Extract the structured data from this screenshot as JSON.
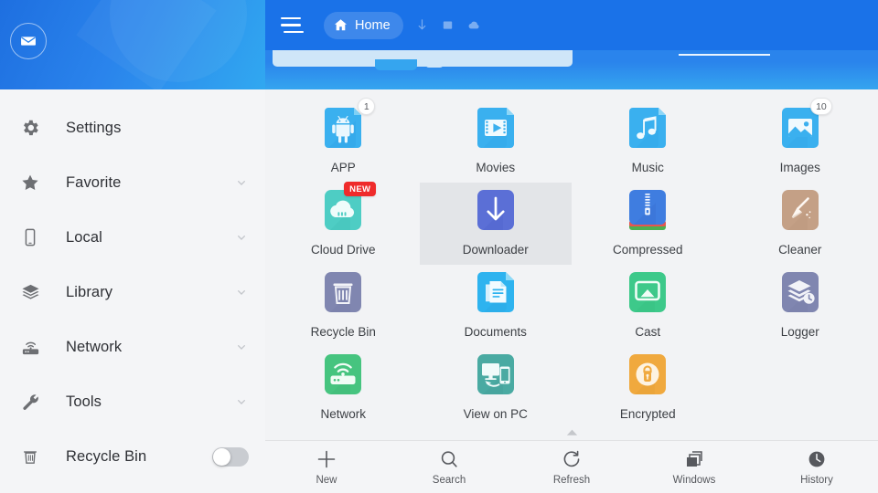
{
  "sidebar": {
    "header": {
      "avatar_icon": "mail-envelope-icon"
    },
    "items": [
      {
        "label": "Settings",
        "icon": "gear-icon",
        "chevron": false,
        "toggle": false
      },
      {
        "label": "Favorite",
        "icon": "star-icon",
        "chevron": true,
        "toggle": false
      },
      {
        "label": "Local",
        "icon": "phone-icon",
        "chevron": true,
        "toggle": false
      },
      {
        "label": "Library",
        "icon": "layers-icon",
        "chevron": true,
        "toggle": false
      },
      {
        "label": "Network",
        "icon": "router-icon",
        "chevron": true,
        "toggle": false
      },
      {
        "label": "Tools",
        "icon": "wrench-icon",
        "chevron": true,
        "toggle": false
      },
      {
        "label": "Recycle Bin",
        "icon": "trash-icon",
        "chevron": false,
        "toggle": true,
        "toggle_on": false
      }
    ]
  },
  "topbar": {
    "menu_icon": "hamburger-menu-icon",
    "home_label": "Home",
    "home_icon": "house-icon",
    "icons": [
      "download-arrow-icon",
      "stop-square-icon",
      "cloud-icon"
    ],
    "background_color": "#1a72e8"
  },
  "grid": {
    "items": [
      {
        "label": "APP",
        "icon": "android-robot-icon",
        "color": "#3ab0ef",
        "badge": "1",
        "badge_type": "count",
        "selected": false
      },
      {
        "label": "Movies",
        "icon": "movie-play-icon",
        "color": "#3ab0ef",
        "badge": null,
        "badge_type": null,
        "selected": false
      },
      {
        "label": "Music",
        "icon": "music-note-icon",
        "color": "#3ab0ef",
        "badge": null,
        "badge_type": null,
        "selected": false
      },
      {
        "label": "Images",
        "icon": "photo-image-icon",
        "color": "#3ab0ef",
        "badge": "10",
        "badge_type": "count",
        "selected": false
      },
      {
        "label": "Cloud Drive",
        "icon": "cloud-drive-icon",
        "color": "#4ecdc4",
        "badge": "NEW",
        "badge_type": "new",
        "selected": false
      },
      {
        "label": "Downloader",
        "icon": "download-arrow-icon",
        "color": "#5b6fd6",
        "badge": null,
        "badge_type": null,
        "selected": true
      },
      {
        "label": "Compressed",
        "icon": "zipper-icon",
        "color": "#3f7de0",
        "badge": null,
        "badge_type": null,
        "selected": false
      },
      {
        "label": "Cleaner",
        "icon": "broom-icon",
        "color": "#c4a086",
        "badge": null,
        "badge_type": null,
        "selected": false
      },
      {
        "label": "Recycle Bin",
        "icon": "trash-bin-icon",
        "color": "#8086b0",
        "badge": null,
        "badge_type": null,
        "selected": false
      },
      {
        "label": "Documents",
        "icon": "document-icon",
        "color": "#2eb3ef",
        "badge": null,
        "badge_type": null,
        "selected": false
      },
      {
        "label": "Cast",
        "icon": "screen-cast-icon",
        "color": "#3dc98a",
        "badge": null,
        "badge_type": null,
        "selected": false
      },
      {
        "label": "Logger",
        "icon": "logger-layers-icon",
        "color": "#8086b0",
        "badge": null,
        "badge_type": null,
        "selected": false
      },
      {
        "label": "Network",
        "icon": "router-wifi-icon",
        "color": "#46c47f",
        "badge": null,
        "badge_type": null,
        "selected": false
      },
      {
        "label": "View on PC",
        "icon": "monitor-phone-icon",
        "color": "#4aaaa2",
        "badge": null,
        "badge_type": null,
        "selected": false
      },
      {
        "label": "Encrypted",
        "icon": "lock-circle-icon",
        "color": "#f0a93e",
        "badge": null,
        "badge_type": null,
        "selected": false
      }
    ],
    "collapse_icon": "chevron-up-icon"
  },
  "bottombar": {
    "items": [
      {
        "label": "New",
        "icon": "plus-icon"
      },
      {
        "label": "Search",
        "icon": "search-icon"
      },
      {
        "label": "Refresh",
        "icon": "refresh-icon"
      },
      {
        "label": "Windows",
        "icon": "windows-stack-icon"
      },
      {
        "label": "History",
        "icon": "clock-icon"
      }
    ]
  }
}
